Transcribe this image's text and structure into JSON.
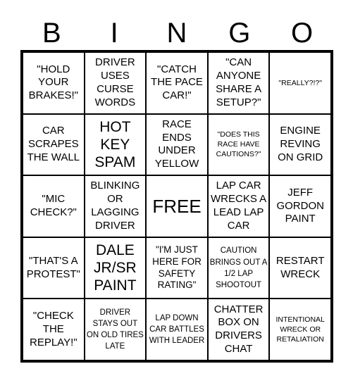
{
  "header": [
    "B",
    "I",
    "N",
    "G",
    "O"
  ],
  "cells": [
    "\"HOLD YOUR BRAKES!\"",
    "DRIVER USES CURSE WORDS",
    "\"CATCH THE PACE CAR!\"",
    "\"CAN ANYONE SHARE A SETUP?\"",
    "\"REALLY?!?\"",
    "CAR SCRAPES THE WALL",
    "HOT KEY SPAM",
    "RACE ENDS UNDER YELLOW",
    "\"DOES THIS RACE HAVE CAUTIONS?\"",
    "ENGINE REVING ON GRID",
    "\"MIC CHECK?\"",
    "BLINKING OR LAGGING DRIVER",
    "FREE",
    "LAP CAR WRECKS A LEAD LAP CAR",
    "JEFF GORDON PAINT",
    "\"THAT'S A PROTEST\"",
    "DALE JR/SR PAINT",
    "\"I'M JUST HERE FOR SAFETY RATING\"",
    "CAUTION BRINGS OUT A 1/2 LAP SHOOTOUT",
    "RESTART WRECK",
    "\"CHECK THE REPLAY!\"",
    "DRIVER STAYS OUT ON OLD TIRES LATE",
    "LAP DOWN CAR BATTLES WITH LEADER",
    "CHATTER BOX ON DRIVERS CHAT",
    "INTENTIONAL WRECK OR RETALIATION"
  ]
}
